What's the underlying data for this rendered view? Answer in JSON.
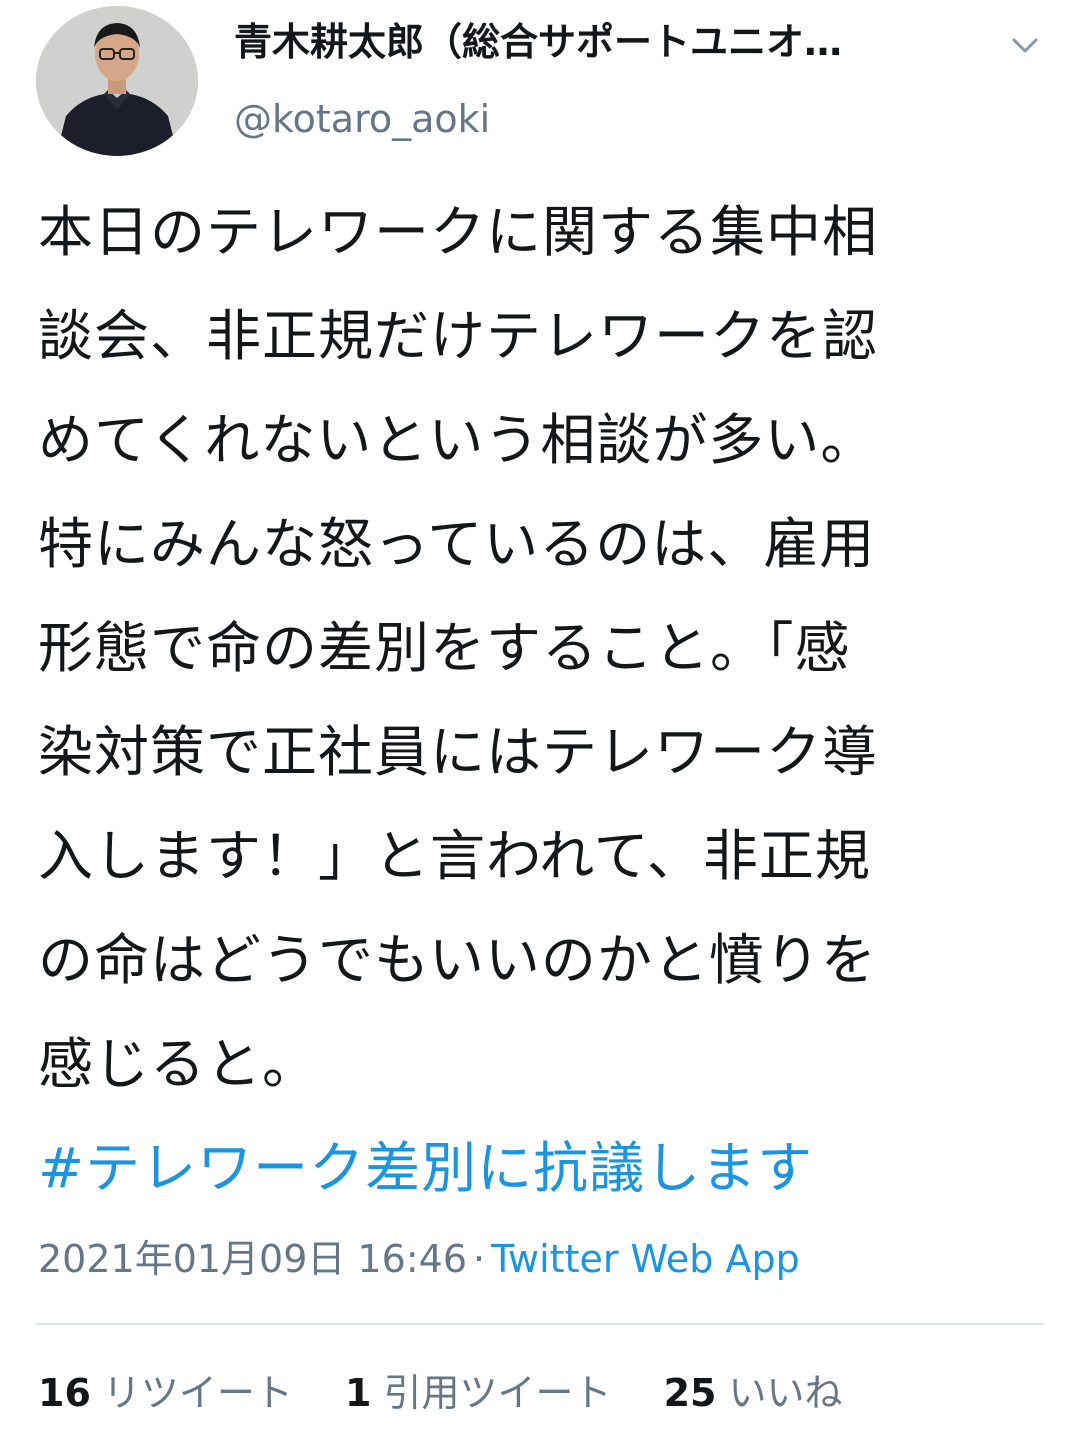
{
  "author": {
    "display_name": "青木耕太郎（総合サポートユニオ…",
    "handle": "@kotaro_aoki"
  },
  "tweet": {
    "lines": [
      "本日のテレワークに関する集中相",
      "談会、非正規だけテレワークを認",
      "めてくれないという相談が多い。",
      "特にみんな怒っているのは、雇用",
      "形態で命の差別をすること。「感",
      "染対策で正社員にはテレワーク導",
      "入します！」と言われて、非正規",
      "の命はどうでもいいのかと憤りを",
      "感じると。"
    ],
    "hashtag": "#テレワーク差別に抗議します"
  },
  "meta": {
    "timestamp": "2021年01月09日 16:46",
    "separator": "·",
    "source": "Twitter Web App"
  },
  "stats": {
    "retweets": {
      "count": "16",
      "label": "リツイート"
    },
    "quotes": {
      "count": "1",
      "label": "引用ツイート"
    },
    "likes": {
      "count": "25",
      "label": "いいね"
    }
  },
  "colors": {
    "link": "#1b95e0",
    "secondary_text": "#657786",
    "primary_text": "#14171a",
    "divider": "#e1e8ed"
  },
  "icons": {
    "caret": "chevron-down-icon",
    "avatar": "user-avatar-photo"
  }
}
